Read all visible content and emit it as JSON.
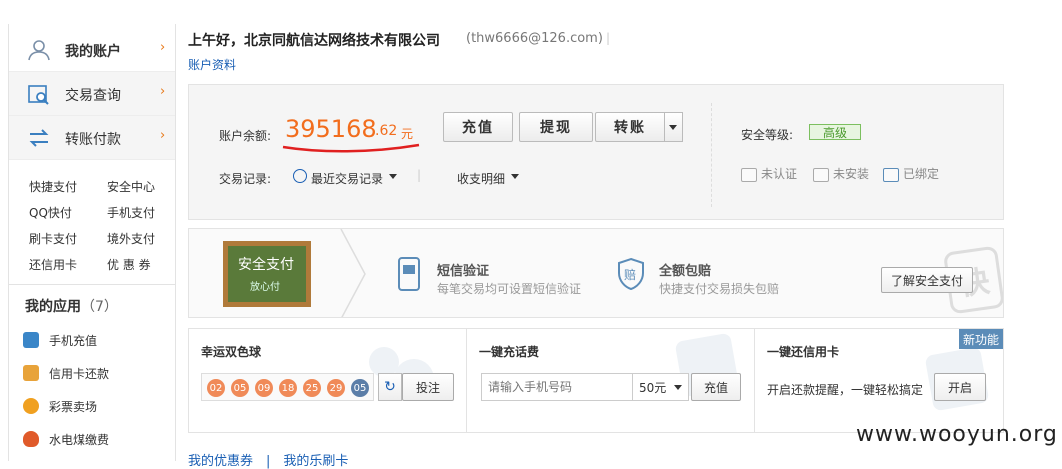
{
  "sidebar": {
    "main": [
      {
        "label": "我的账户"
      },
      {
        "label": "交易查询"
      },
      {
        "label": "转账付款"
      }
    ],
    "quick_links": [
      "快捷支付",
      "安全中心",
      "QQ快付",
      "手机支付",
      "刷卡支付",
      "境外支付",
      "还信用卡",
      "优 惠 券"
    ],
    "apps_title": "我的应用",
    "apps_count": "（7）",
    "apps": [
      {
        "label": "手机充值",
        "color": "#3a86c8"
      },
      {
        "label": "信用卡还款",
        "color": "#e8a33a"
      },
      {
        "label": "彩票卖场",
        "color": "#f0a020"
      },
      {
        "label": "水电煤缴费",
        "color": "#e05a2a"
      }
    ],
    "chevron": "›"
  },
  "header": {
    "greeting": "上午好，北京同航信达网络技术有限公司",
    "email": "(thw6666@126.com)",
    "separator": "|",
    "profile_link": "账户资料"
  },
  "account": {
    "balance_label": "账户余额:",
    "balance_integer": "395168",
    "balance_decimal": ".62",
    "currency": "元",
    "buttons": {
      "recharge": "充值",
      "withdraw": "提现",
      "transfer": "转账"
    },
    "records_label": "交易记录:",
    "recent_records": "最近交易记录",
    "income_detail": "收支明细",
    "security_label": "安全等级:",
    "security_level": "高级",
    "security_items": [
      "未认证",
      "未安装",
      "已绑定"
    ]
  },
  "banner": {
    "board_text": "安全支付",
    "board_subtext": "放心付",
    "features": [
      {
        "title": "短信验证",
        "desc": "每笔交易均可设置短信验证"
      },
      {
        "title": "全额包赔",
        "desc": "快捷支付交易损失包赔"
      }
    ],
    "learn_button": "了解安全支付",
    "watermark_glyph": "快"
  },
  "cards": {
    "lottery": {
      "title": "幸运双色球",
      "balls": [
        "02",
        "05",
        "09",
        "18",
        "25",
        "29",
        "05"
      ],
      "bet_button": "投注",
      "refresh_icon": "↻"
    },
    "recharge": {
      "title": "一键充话费",
      "placeholder": "请输入手机号码",
      "amount": "50元",
      "button": "充值"
    },
    "credit": {
      "title": "一键还信用卡",
      "new_badge": "新功能",
      "desc": "开启还款提醒，一键轻松搞定",
      "button": "开启"
    }
  },
  "footer": {
    "links": "我的优惠券　|　我的乐刷卡"
  },
  "watermark": "www.wooyun.org",
  "colors": {
    "accent": "#f26d1d",
    "link": "#1a5fb4",
    "badge": "#5b8cb8"
  }
}
